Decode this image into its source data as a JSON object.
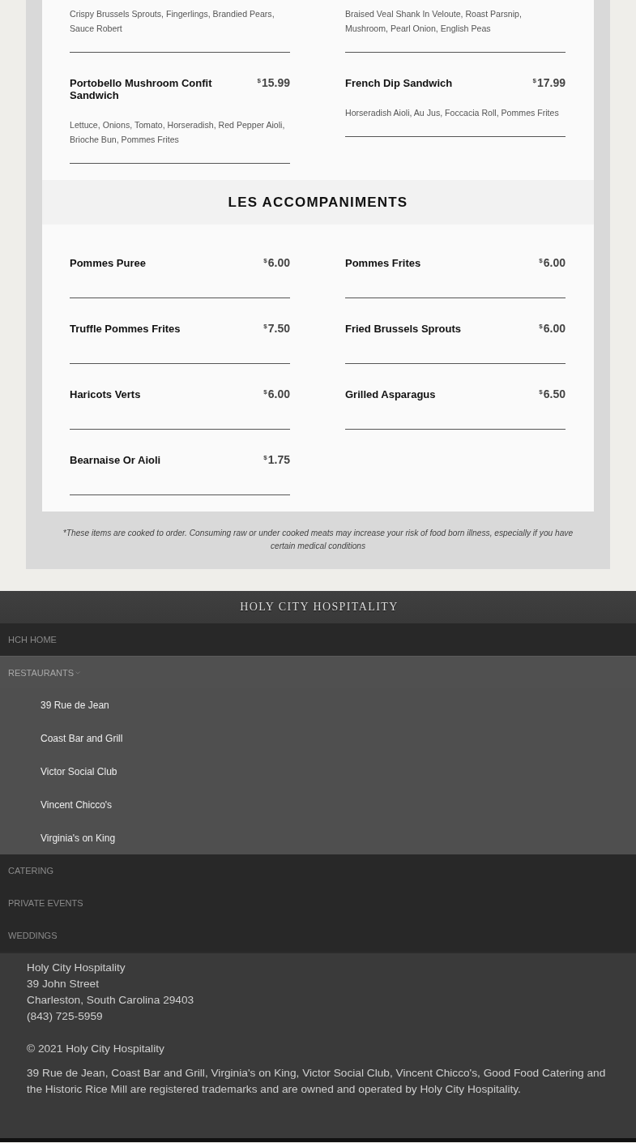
{
  "menu": {
    "sections": [
      {
        "items": [
          {
            "description": "Crispy Brussels Sprouts, Fingerlings, Brandied Pears, Sauce Robert"
          },
          {
            "description": "Braised Veal Shank In Veloute, Roast Parsnip, Mushroom, Pearl Onion, English Peas"
          },
          {
            "name": "Portobello Mushroom Confit Sandwich",
            "currency": "$",
            "price": "15.99",
            "description": "Lettuce, Onions, Tomato, Horseradish, Red Pepper Aioli, Brioche Bun, Pommes Frites"
          },
          {
            "name": "French Dip Sandwich",
            "currency": "$",
            "price": "17.99",
            "description": "Horseradish Aioli, Au Jus, Foccacia Roll, Pommes Frites"
          }
        ]
      },
      {
        "title": "LES ACCOMPANIMENTS",
        "items": [
          {
            "name": "Pommes Puree",
            "currency": "$",
            "price": "6.00"
          },
          {
            "name": "Pommes Frites",
            "currency": "$",
            "price": "6.00"
          },
          {
            "name": "Truffle Pommes Frites",
            "currency": "$",
            "price": "7.50"
          },
          {
            "name": "Fried Brussels Sprouts",
            "currency": "$",
            "price": "6.00"
          },
          {
            "name": "Haricots Verts",
            "currency": "$",
            "price": "6.00"
          },
          {
            "name": "Grilled Asparagus",
            "currency": "$",
            "price": "6.50"
          },
          {
            "name": "Bearnaise Or Aioli",
            "currency": "$",
            "price": "1.75"
          }
        ]
      }
    ],
    "disclaimer": "*These items are cooked to order. Consuming raw or under cooked meats may increase your risk of food born illness, especially if you have certain medical conditions"
  },
  "footer": {
    "brand": "HOLY CITY HOSPITALITY",
    "nav": [
      {
        "label": "HCH HOME",
        "expanded": false
      },
      {
        "label": "RESTAURANTS",
        "expanded": true,
        "children": [
          {
            "label": "39 Rue de Jean"
          },
          {
            "label": "Coast Bar and Grill"
          },
          {
            "label": "Victor Social Club"
          },
          {
            "label": "Vincent Chicco's"
          },
          {
            "label": "Virginia's on King"
          }
        ]
      },
      {
        "label": "CATERING",
        "expanded": false
      },
      {
        "label": "PRIVATE EVENTS",
        "expanded": false
      },
      {
        "label": "WEDDINGS",
        "expanded": false
      }
    ],
    "address": [
      "Holy City Hospitality",
      "39 John Street",
      "Charleston, South Carolina 29403",
      "(843) 725-5959"
    ],
    "copyright": "© 2021 Holy City Hospitality",
    "trademark": "39 Rue de Jean, Coast Bar and Grill, Virginia's on King, Victor Social Club, Vincent Chicco's, Good Food Catering and the Historic Rice Mill are registered trademarks and are owned and operated by Holy City Hospitality."
  }
}
